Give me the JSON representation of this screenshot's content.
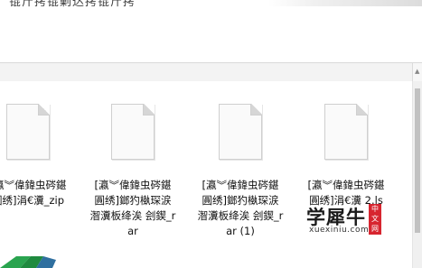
{
  "window": {
    "title_fragment": "锟斤拷锟剿达拷锟斤拷"
  },
  "files": [
    {
      "name": "[瀛︾偉鍏虫硶鍖圓绣]涓€瀵_zip"
    },
    {
      "name": "[瀛︾偉鍏虫硶鍖圓绣]鎯犳槸琛涙潪瀵板绛涘 刽鍥_rar"
    },
    {
      "name": "[瀛︾偉鍏虫硶鍖圓绣]鎯犳槸琛涙潪瀵板绛涘 刽鍥_rar (1)"
    },
    {
      "name": "[瀛︾偉鍏虫硶鍖圓绣]涓€瀵 2.ls"
    }
  ],
  "watermark": {
    "main": "学犀牛",
    "badge": "中文网",
    "url": "xuexiniu.com"
  },
  "colors": {
    "accent_red": "#d7252f",
    "bar_bg": "#f3f3f3",
    "green": "#2aa44f"
  }
}
